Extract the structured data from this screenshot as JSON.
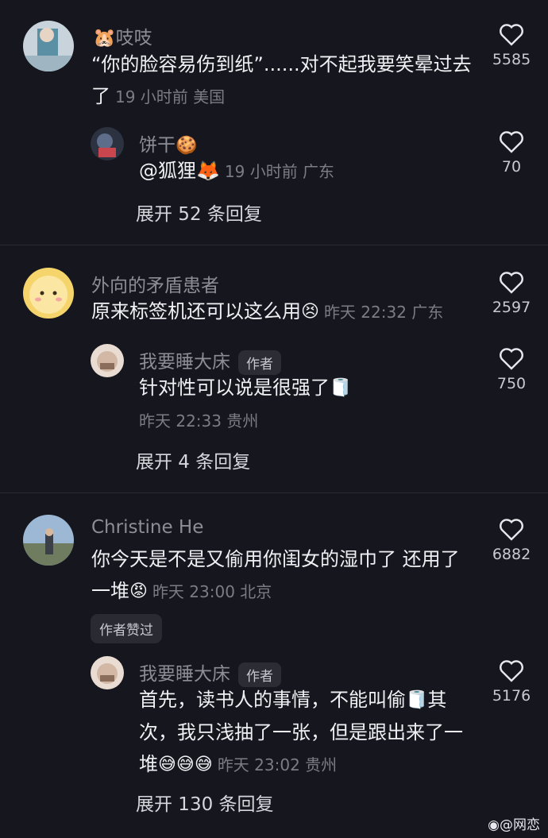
{
  "comments": [
    {
      "name": "吱吱",
      "name_emoji": "🐹",
      "text": "“你的脸容易伤到纸”......对不起我要笑晕过去了",
      "meta": "19 小时前 美国",
      "likes": "5585",
      "reply": {
        "name": "饼干",
        "name_emoji": "🍪",
        "text": "@狐狸🦊",
        "meta": "19 小时前 广东",
        "likes": "70"
      },
      "expand": "展开 52 条回复"
    },
    {
      "name": "外向的矛盾患者",
      "text": "原来标签机还可以这么用",
      "text_emoji": "😣",
      "meta": "昨天 22:32 广东",
      "likes": "2597",
      "reply": {
        "name": "我要睡大床",
        "badge": "作者",
        "text": "针对性可以说是很强了",
        "text_emoji": "🧻",
        "meta": "昨天 22:33 贵州",
        "likes": "750"
      },
      "expand": "展开 4 条回复"
    },
    {
      "name": "Christine He",
      "text": "你今天是不是又偷用你闺女的湿巾了 还用了一堆",
      "text_emoji": "😡",
      "meta": "昨天 23:00 北京",
      "likes": "6882",
      "liked_by_author": "作者赞过",
      "reply": {
        "name": "我要睡大床",
        "badge": "作者",
        "text": "首先，读书人的事情，不能叫偷",
        "text_emoji": "🧻",
        "text_2": "其次，我只浅抽了一张，但是跟出来了一堆",
        "text_2_emoji": "😅😅😅",
        "meta": "昨天 23:02 贵州",
        "likes": "5176"
      },
      "expand": "展开 130 条回复"
    }
  ],
  "watermark": "@网恋",
  "watermark_icon": "weibo-icon",
  "colors": {
    "background": "#16161e",
    "muted": "#7c7c86"
  }
}
